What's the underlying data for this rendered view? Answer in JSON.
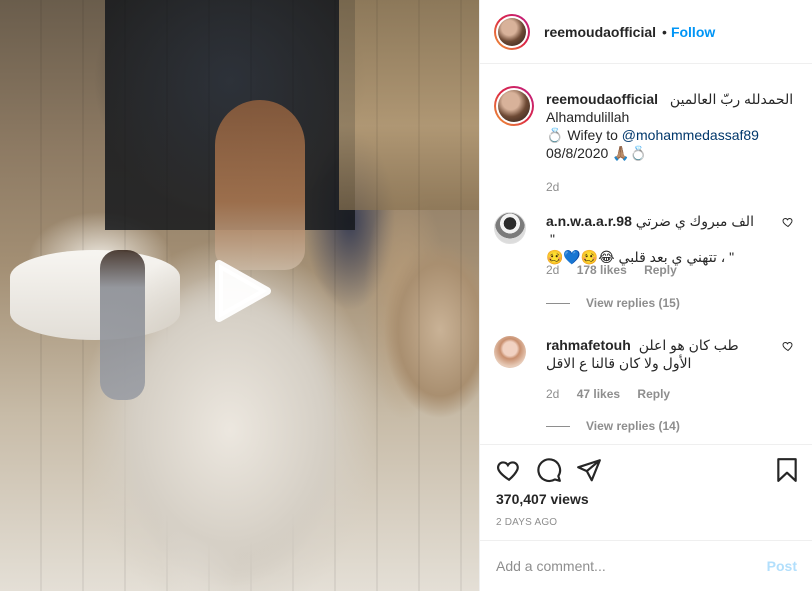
{
  "video": {
    "play_icon": "play-icon"
  },
  "header": {
    "username": "reemoudaofficial",
    "separator": "•",
    "follow_label": "Follow"
  },
  "caption": {
    "username": "reemoudaofficial",
    "arabic": "الحمدلله ربّ العالمين",
    "line2": "Alhamdulillah",
    "line3_prefix": "💍 Wifey to ",
    "mention": "@mohammedassaf89",
    "line4": "08/8/2020 🙏🏽💍",
    "time": "2d"
  },
  "comments": [
    {
      "username": "a.n.w.a.a.r.98",
      "text_line1": "الف مبروك ي ضرتي \"",
      "text_line2": "\" ، تتهني ي بعد قلبي 😂🥴💙🥴",
      "time": "2d",
      "likes": "178 likes",
      "reply": "Reply",
      "view_replies": "View replies (15)"
    },
    {
      "username": "rahmafetouh",
      "text_line1": "طب كان هو اعلن",
      "text_line2": "الأول ولا كان قالنا ع الاقل",
      "time": "2d",
      "likes": "47 likes",
      "reply": "Reply",
      "view_replies": "View replies (14)"
    }
  ],
  "actions": {
    "views": "370,407 views",
    "posted_ago": "2 DAYS AGO"
  },
  "add_comment": {
    "placeholder": "Add a comment...",
    "post_label": "Post"
  },
  "colors": {
    "accent_blue": "#0095f6",
    "post_disabled": "#b2dffc",
    "muted": "#8e8e8e"
  }
}
